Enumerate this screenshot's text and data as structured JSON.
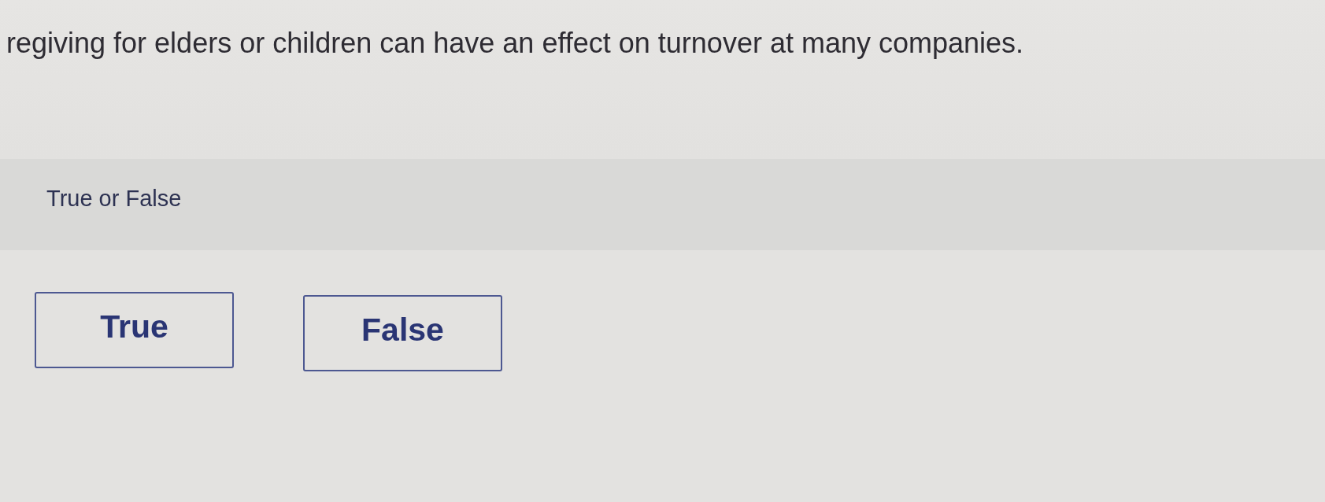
{
  "question": {
    "text": "regiving for elders or children can have an effect on turnover at many companies."
  },
  "prompt": {
    "text": "True or False"
  },
  "options": [
    {
      "label": "True",
      "selected": false
    },
    {
      "label": "False",
      "selected": false
    }
  ]
}
